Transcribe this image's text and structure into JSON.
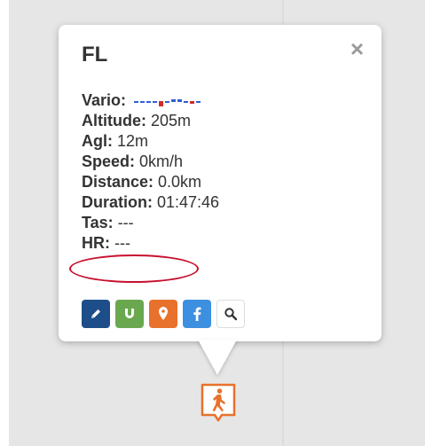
{
  "popup": {
    "title": "FL",
    "close_label": "×",
    "rows": [
      {
        "label": "Vario:",
        "value": ""
      },
      {
        "label": "Altitude:",
        "value": "205m"
      },
      {
        "label": "Agl:",
        "value": "12m"
      },
      {
        "label": "Speed:",
        "value": "0km/h"
      },
      {
        "label": "Distance:",
        "value": "0.0km"
      },
      {
        "label": "Duration:",
        "value": "01:47:46"
      },
      {
        "label": "Tas:",
        "value": "---"
      },
      {
        "label": "HR:",
        "value": "---"
      }
    ],
    "actions": [
      {
        "name": "edit-button",
        "icon": "pencil-icon",
        "color": "#1d4e89"
      },
      {
        "name": "magnet-button",
        "icon": "magnet-icon",
        "color": "#6aa84f"
      },
      {
        "name": "location-button",
        "icon": "map-pin-icon",
        "color": "#e8712b"
      },
      {
        "name": "facebook-button",
        "icon": "facebook-icon",
        "color": "#3d8fe0"
      },
      {
        "name": "search-button",
        "icon": "search-icon",
        "color": "#ffffff"
      }
    ]
  },
  "highlight": {
    "target": "HR",
    "color": "#c8102e"
  },
  "marker": {
    "icon": "walking-person-icon",
    "color": "#e8712b"
  }
}
